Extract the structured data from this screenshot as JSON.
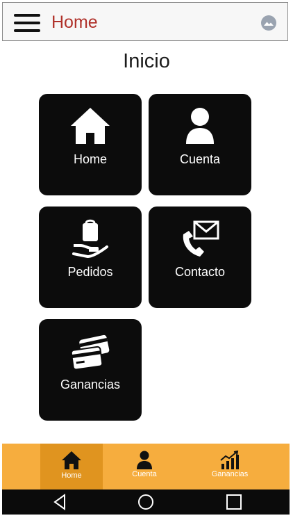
{
  "topbar": {
    "title": "Home",
    "menu_icon": "menu-icon",
    "avatar_icon": "user-avatar-icon"
  },
  "page": {
    "title": "Inicio"
  },
  "tiles": [
    {
      "label": "Home",
      "icon": "home-icon"
    },
    {
      "label": "Cuenta",
      "icon": "user-icon"
    },
    {
      "label": "Pedidos",
      "icon": "hand-bag-icon"
    },
    {
      "label": "Contacto",
      "icon": "phone-mail-icon"
    },
    {
      "label": "Ganancias",
      "icon": "credit-cards-icon"
    }
  ],
  "bottom_nav": [
    {
      "label": "Home",
      "icon": "home-icon",
      "active": true
    },
    {
      "label": "Cuenta",
      "icon": "user-icon",
      "active": false
    },
    {
      "label": "Ganancias",
      "icon": "bar-chart-icon",
      "active": false
    }
  ],
  "system_nav": {
    "back": "back-icon",
    "home": "home-circle-icon",
    "recents": "recents-icon"
  },
  "colors": {
    "title_red": "#b0312a",
    "tile_bg": "#0c0c0c",
    "nav_bg": "#f6ad3e",
    "nav_active": "#e0941f",
    "system_bar": "#0b0b0b"
  }
}
